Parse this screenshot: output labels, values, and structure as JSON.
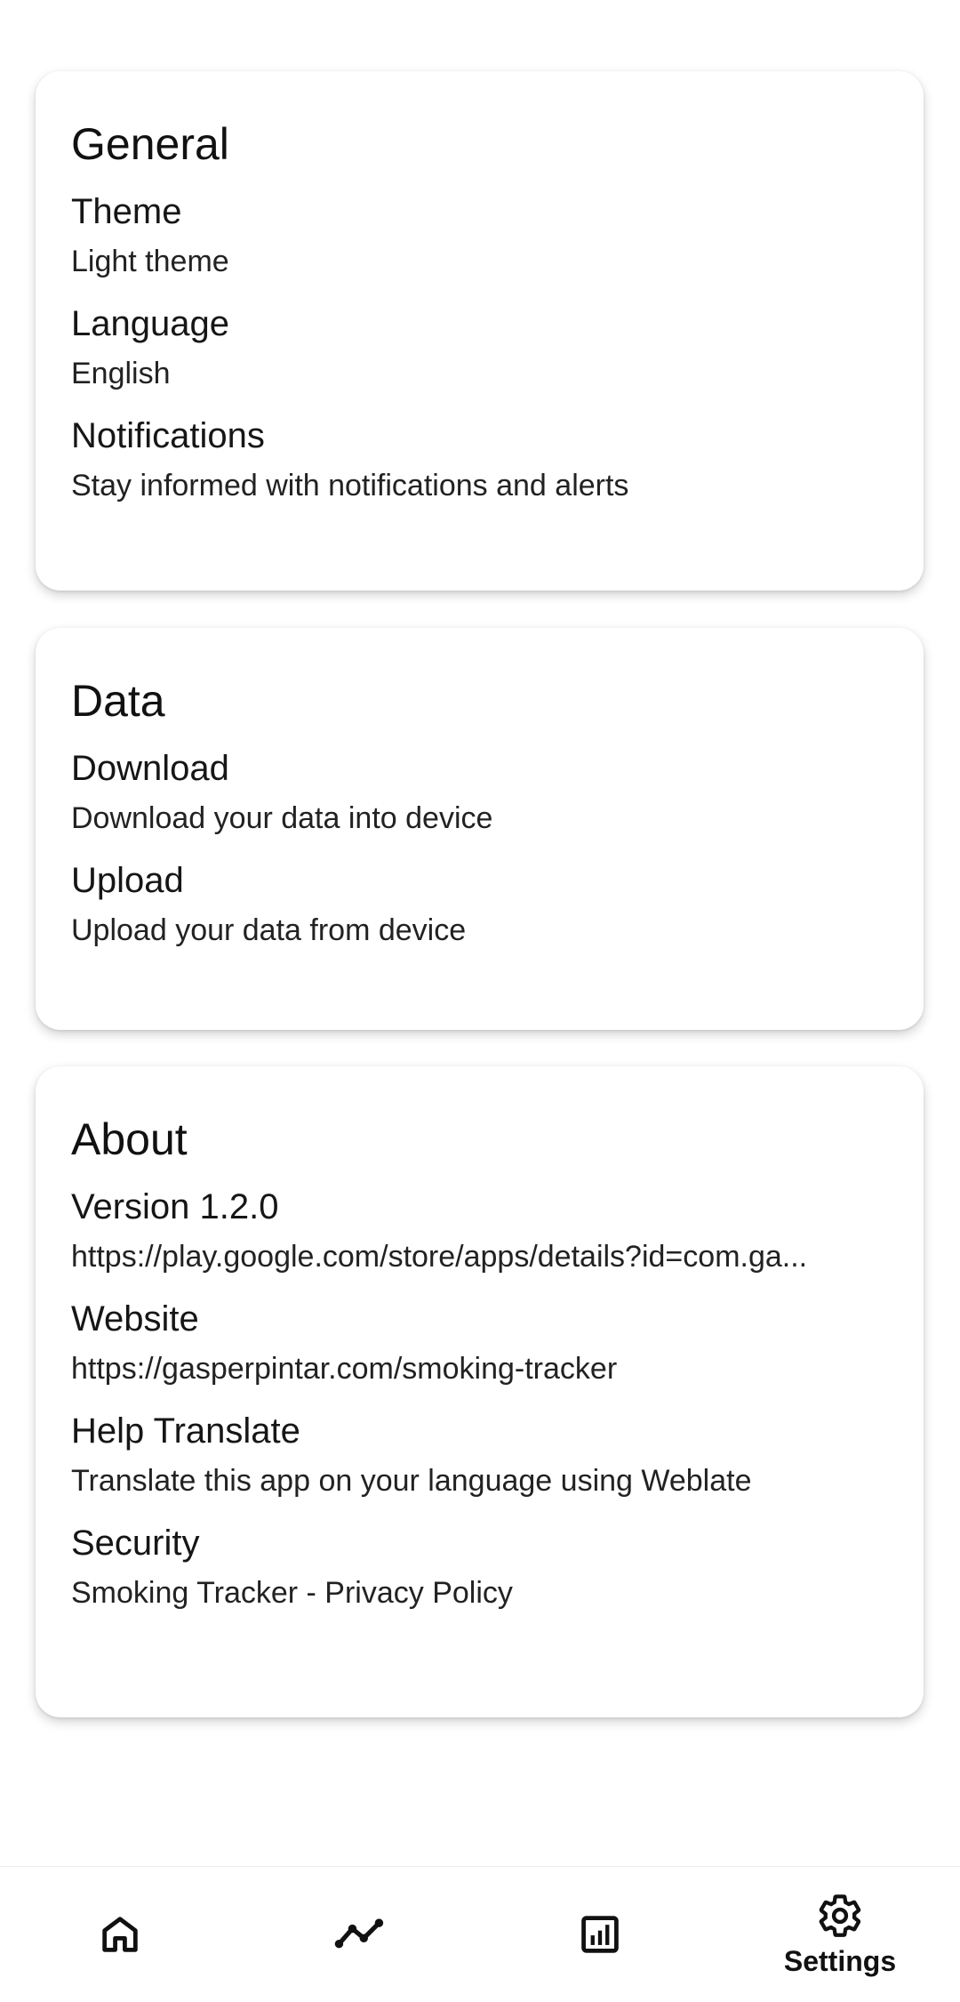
{
  "sections": {
    "general": {
      "title": "General",
      "items": [
        {
          "title": "Theme",
          "subtitle": "Light theme"
        },
        {
          "title": "Language",
          "subtitle": "English"
        },
        {
          "title": "Notifications",
          "subtitle": "Stay informed with notifications and alerts"
        }
      ]
    },
    "data": {
      "title": "Data",
      "items": [
        {
          "title": "Download",
          "subtitle": "Download your data into device"
        },
        {
          "title": "Upload",
          "subtitle": "Upload your data from device"
        }
      ]
    },
    "about": {
      "title": "About",
      "items": [
        {
          "title": "Version 1.2.0",
          "subtitle": "https://play.google.com/store/apps/details?id=com.ga..."
        },
        {
          "title": "Website",
          "subtitle": "https://gasperpintar.com/smoking-tracker"
        },
        {
          "title": "Help Translate",
          "subtitle": "Translate this app on your language using Weblate"
        },
        {
          "title": "Security",
          "subtitle": "Smoking Tracker - Privacy Policy"
        }
      ]
    }
  },
  "bottom_nav": {
    "items": [
      {
        "icon": "home-icon"
      },
      {
        "icon": "trend-icon"
      },
      {
        "icon": "stats-icon"
      },
      {
        "icon": "gear-icon",
        "label": "Settings",
        "selected": true
      }
    ]
  }
}
